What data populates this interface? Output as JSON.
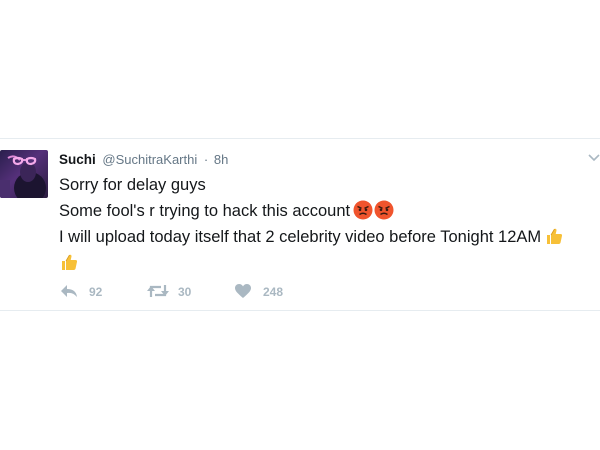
{
  "tweet": {
    "display_name": "Suchi",
    "handle": "@SuchitraKarthi",
    "separator": "·",
    "timestamp": "8h",
    "lines": [
      "Sorry for delay guys",
      "Some fool's r trying to hack this account",
      "I will upload today itself that 2 celebrity video before Tonight 12AM"
    ],
    "emojis": {
      "line2": [
        "angry-face-icon",
        "angry-face-icon"
      ],
      "line3": [
        "thumbs-up-icon"
      ],
      "line4": [
        "thumbs-up-icon"
      ]
    },
    "actions": {
      "reply_count": "92",
      "retweet_count": "30",
      "like_count": "248"
    }
  },
  "colors": {
    "text": "#14171a",
    "secondary": "#657786",
    "action_icon": "#aab8c2",
    "divider": "#e6ecf0",
    "emoji_angry": "#f0542d",
    "emoji_thumb": "#f7c038"
  }
}
